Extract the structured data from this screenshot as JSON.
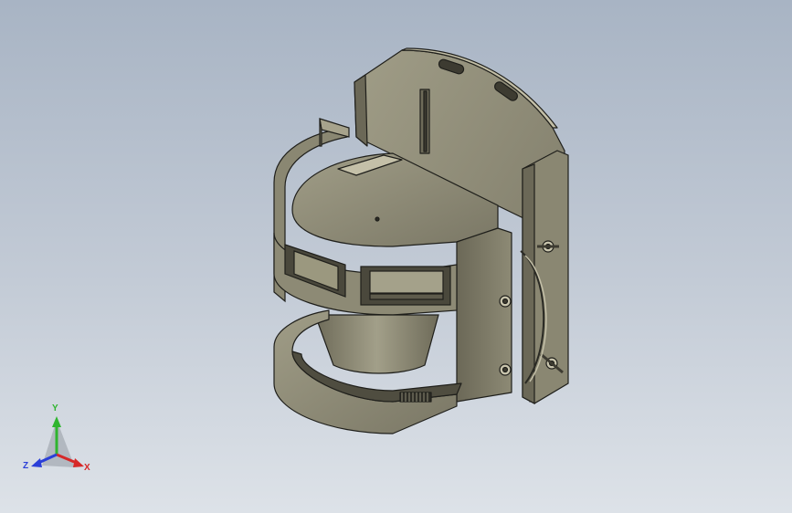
{
  "viewport": {
    "background_top": "#a8b4c4",
    "background_bottom": "#dde2e8"
  },
  "model": {
    "body_color": "#8f8c77",
    "body_dark": "#5e5b4c",
    "body_light": "#b3af97",
    "edge_color": "#1f1f1b"
  },
  "triad": {
    "x_label": "X",
    "y_label": "Y",
    "z_label": "Z",
    "x_color": "#d62828",
    "y_color": "#2fb52f",
    "z_color": "#2a3fd8"
  }
}
